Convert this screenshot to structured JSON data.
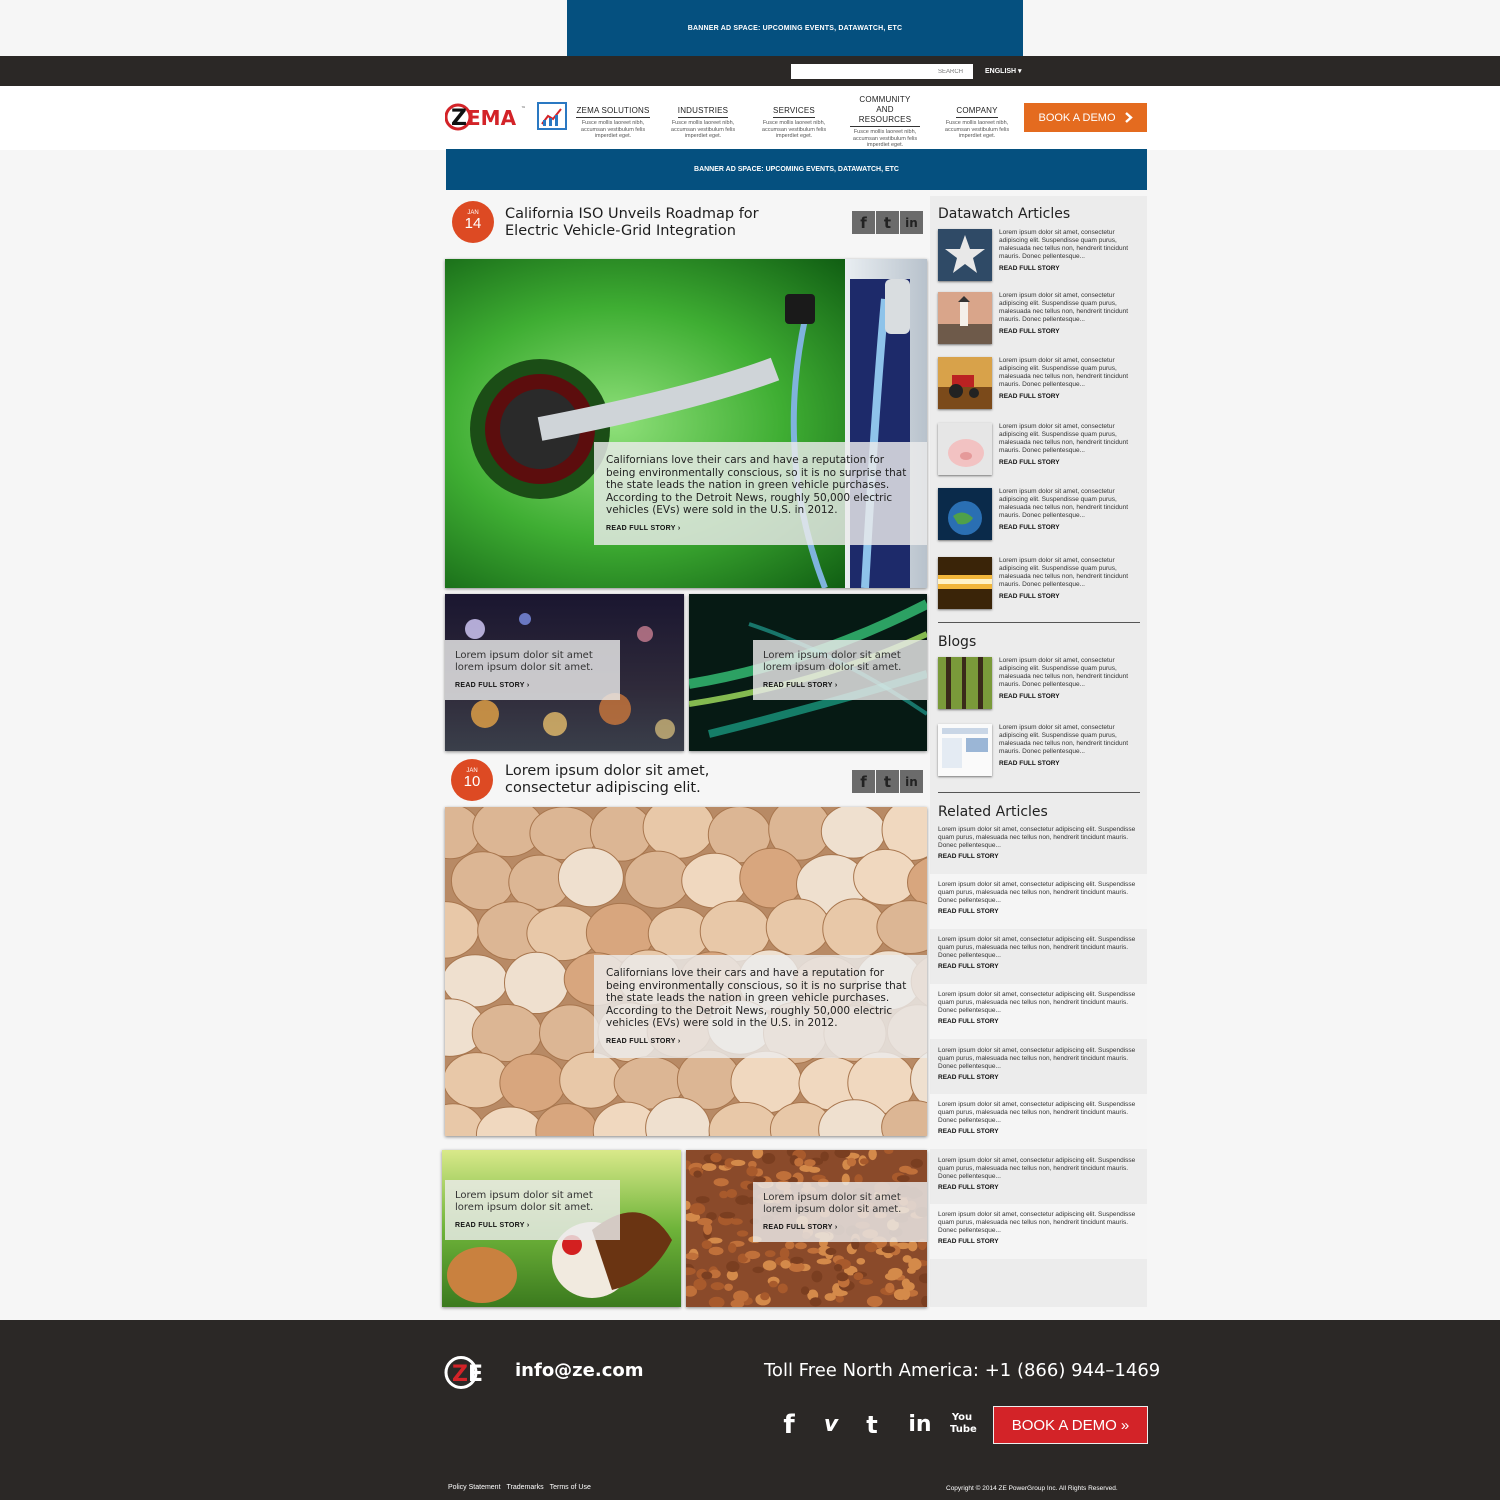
{
  "top_banner": "BANNER AD SPACE: UPCOMING EVENTS, DATAWATCH, ETC",
  "search_placeholder": "SEARCH",
  "language": "ENGLISH ▾",
  "logo_text": "ZEMA",
  "nav": [
    {
      "title": "ZEMA SOLUTIONS",
      "sub": "Fusce mollis laoreet nibh, accumsan vestibulum felis imperdiet eget."
    },
    {
      "title": "INDUSTRIES",
      "sub": "Fusce mollis laoreet nibh, accumsan vestibulum felis imperdiet eget."
    },
    {
      "title": "SERVICES",
      "sub": "Fusce mollis laoreet nibh, accumsan vestibulum felis imperdiet eget."
    },
    {
      "title": "COMMUNITY AND RESOURCES",
      "sub": "Fusce mollis laoreet nibh, accumsan vestibulum felis imperdiet eget."
    },
    {
      "title": "COMPANY",
      "sub": "Fusce mollis laoreet nibh, accumsan vestibulum felis imperdiet eget."
    }
  ],
  "book_demo": "BOOK A DEMO",
  "mid_banner": "BANNER AD SPACE: UPCOMING EVENTS, DATAWATCH, ETC",
  "articles": [
    {
      "month": "JAN",
      "day": "14",
      "title": "California ISO Unveils Roadmap for Electric Vehicle-Grid Integration",
      "excerpt": "Californians love their cars and have a reputation for being environmentally conscious, so it is no surprise that the state leads the nation in green vehicle purchases. According to the Detroit News, roughly 50,000 electric vehicles (EVs) were sold in the U.S. in 2012.",
      "read": "READ FULL STORY ›",
      "tiles": [
        {
          "text": "Lorem ipsum dolor sit amet lorem ipsum dolor sit amet.",
          "read": "READ FULL STORY ›"
        },
        {
          "text": "Lorem ipsum dolor sit amet lorem ipsum dolor sit amet.",
          "read": "READ FULL STORY ›"
        }
      ]
    },
    {
      "month": "JAN",
      "day": "10",
      "title": "Lorem ipsum dolor sit amet, consectetur adipiscing elit.",
      "excerpt": "Californians love their cars and have a reputation for being environmentally conscious, so it is no surprise that the state leads the nation in green vehicle purchases. According to the Detroit News, roughly 50,000 electric vehicles (EVs) were sold in the U.S. in 2012.",
      "read": "READ FULL STORY ›",
      "tiles": [
        {
          "text": "Lorem ipsum dolor sit amet lorem ipsum dolor sit amet.",
          "read": "READ FULL STORY ›"
        },
        {
          "text": "Lorem ipsum dolor sit amet lorem ipsum dolor sit amet.",
          "read": "READ FULL STORY ›"
        }
      ]
    }
  ],
  "social_icons": [
    "f",
    "t",
    "in"
  ],
  "sidebar": {
    "datawatch_title": "Datawatch Articles",
    "blogs_title": "Blogs",
    "related_title": "Related Articles",
    "item_text": "Lorem ipsum dolor sit amet, consectetur adipiscing elit. Suspendisse quam purus, malesuada nec tellus non, hendrerit tincidunt mauris. Donec pellentesque...",
    "read": "READ FULL STORY"
  },
  "footer": {
    "email": "info@ze.com",
    "phone": "Toll Free North America: +1 (866) 944–1469",
    "socials": [
      "f",
      "v",
      "t",
      "in",
      "You Tube"
    ],
    "book_demo": "BOOK A DEMO »",
    "links": [
      "Policy Statement",
      "Trademarks",
      "Terms of Use"
    ],
    "copyright": "Copyright © 2014 ZE PowerGroup Inc. All Rights Reserved."
  },
  "colors": {
    "brand_blue": "#05507f",
    "orange": "#e46b1f",
    "red": "#d32328",
    "badge": "#dd4a23",
    "dark": "#2b2826"
  }
}
